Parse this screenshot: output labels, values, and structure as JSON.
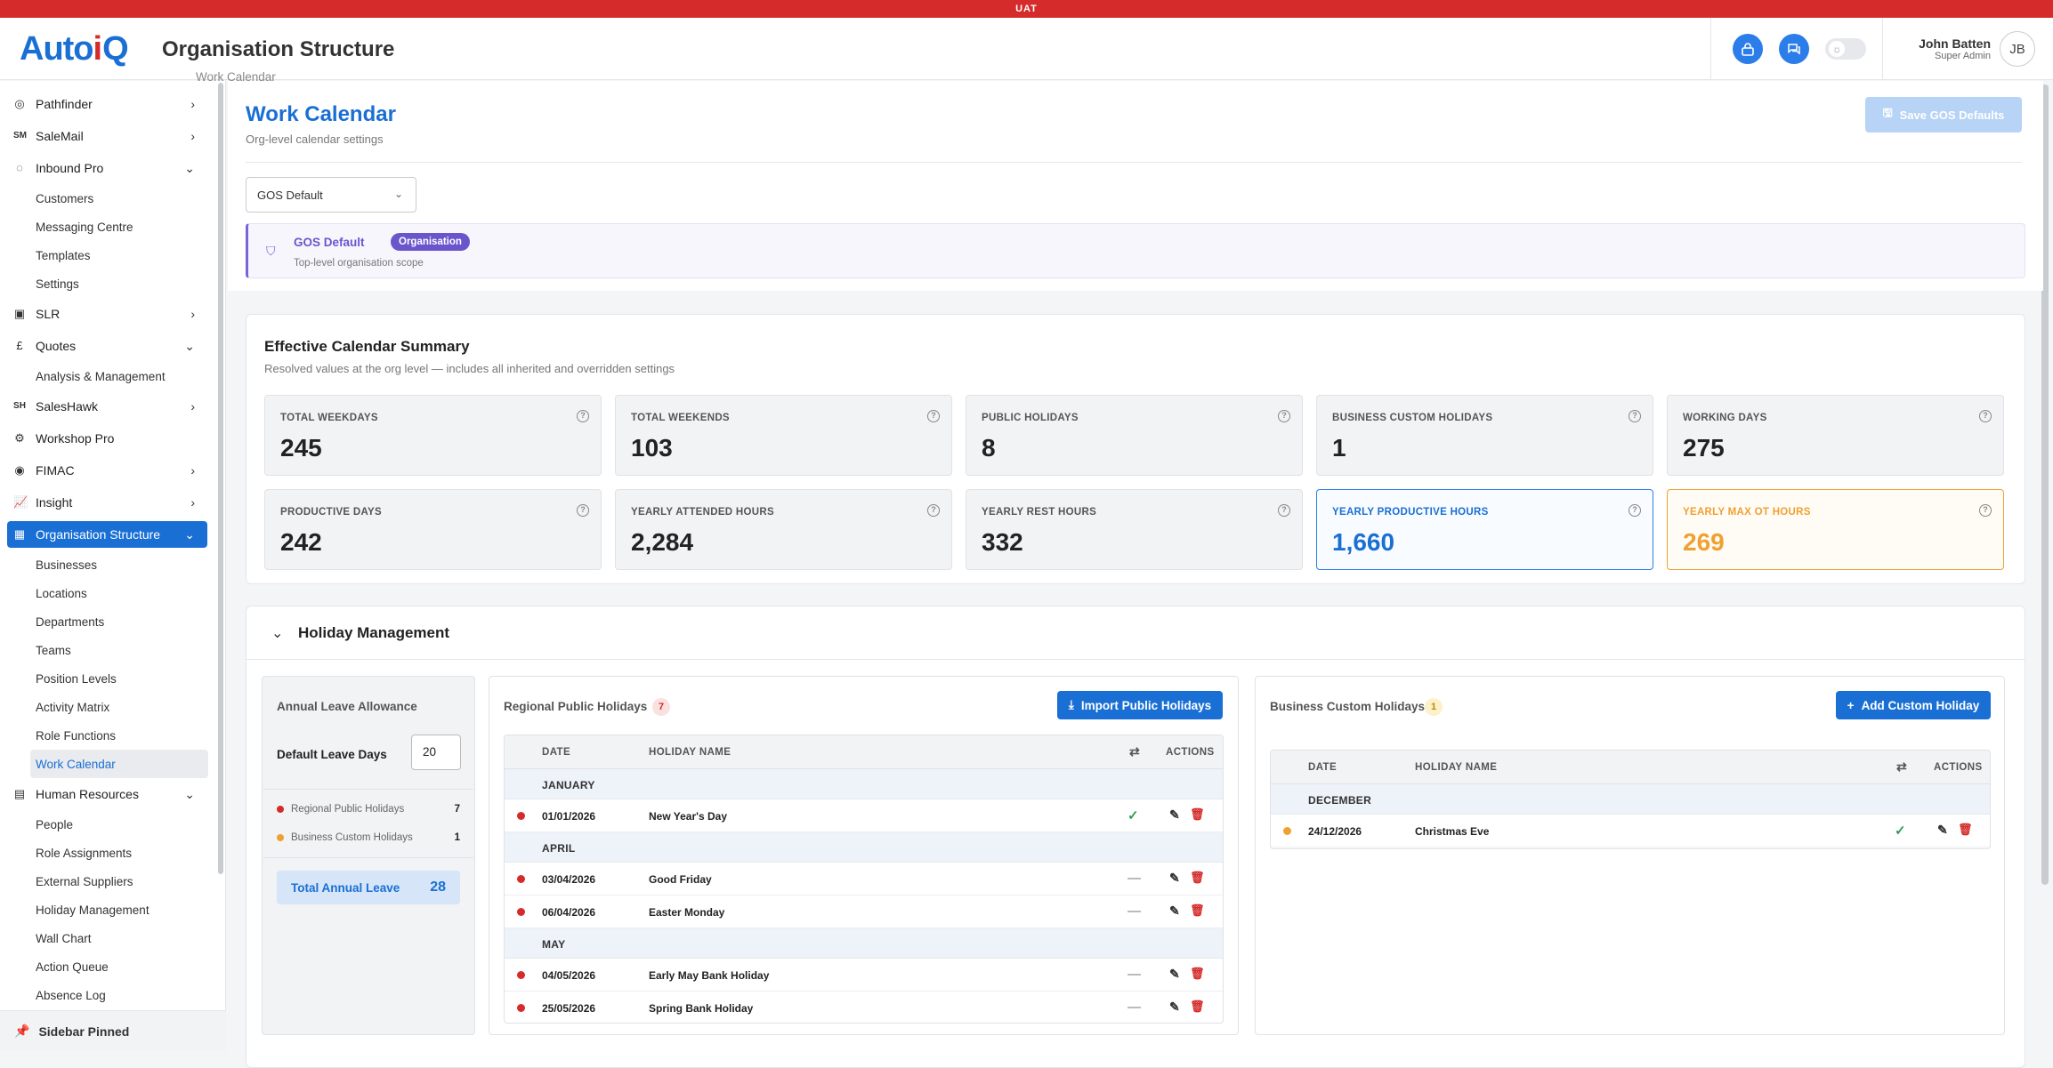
{
  "env_banner": "UAT",
  "app": {
    "logo_main": "Auto",
    "logo_accent": "i",
    "logo_tail": "Q"
  },
  "header": {
    "title": "Organisation Structure",
    "subtitle": "Work Calendar"
  },
  "user": {
    "name": "John Batten",
    "role": "Super Admin",
    "initials": "JB"
  },
  "sidebar": {
    "items": [
      {
        "label": "Pathfinder",
        "icon": "compass-icon"
      },
      {
        "label": "SaleMail",
        "icon": "salemail-icon"
      },
      {
        "label": "Inbound Pro",
        "icon": "inbound-icon"
      },
      {
        "label": "SLR",
        "icon": "slr-icon"
      },
      {
        "label": "Quotes",
        "icon": "quotes-icon"
      },
      {
        "label": "SalesHawk",
        "icon": "saleshawk-icon"
      },
      {
        "label": "Workshop Pro",
        "icon": "workshop-icon"
      },
      {
        "label": "FIMAC",
        "icon": "fimac-icon"
      },
      {
        "label": "Insight",
        "icon": "chart-icon"
      },
      {
        "label": "Organisation Structure",
        "icon": "building-icon"
      },
      {
        "label": "Human Resources",
        "icon": "hr-icon"
      }
    ],
    "inbound_sub": [
      "Customers",
      "Messaging Centre",
      "Templates",
      "Settings"
    ],
    "quotes_sub": [
      "Analysis & Management"
    ],
    "org_sub": [
      "Businesses",
      "Locations",
      "Departments",
      "Teams",
      "Position Levels",
      "Activity Matrix",
      "Role Functions",
      "Work Calendar"
    ],
    "hr_sub": [
      "People",
      "Role Assignments",
      "External Suppliers",
      "Holiday Management",
      "Wall Chart",
      "Action Queue",
      "Absence Log"
    ],
    "pinned": "Sidebar Pinned"
  },
  "page": {
    "title": "Work Calendar",
    "subtitle": "Org-level calendar settings",
    "save_button": "Save GOS Defaults",
    "scope_select": "GOS Default",
    "scope_title": "GOS Default",
    "scope_badge": "Organisation",
    "scope_desc": "Top-level organisation scope"
  },
  "summary": {
    "title": "Effective Calendar Summary",
    "subtitle": "Resolved values at the org level — includes all inherited and overridden settings",
    "cards": [
      {
        "label": "TOTAL WEEKDAYS",
        "value": "245"
      },
      {
        "label": "TOTAL WEEKENDS",
        "value": "103"
      },
      {
        "label": "PUBLIC HOLIDAYS",
        "value": "8"
      },
      {
        "label": "BUSINESS CUSTOM HOLIDAYS",
        "value": "1"
      },
      {
        "label": "WORKING DAYS",
        "value": "275"
      },
      {
        "label": "PRODUCTIVE DAYS",
        "value": "242"
      },
      {
        "label": "YEARLY ATTENDED HOURS",
        "value": "2,284"
      },
      {
        "label": "YEARLY REST HOURS",
        "value": "332"
      },
      {
        "label": "YEARLY PRODUCTIVE HOURS",
        "value": "1,660"
      },
      {
        "label": "YEARLY MAX OT HOURS",
        "value": "269"
      }
    ]
  },
  "holiday": {
    "title": "Holiday Management",
    "leave": {
      "title": "Annual Leave Allowance",
      "default_label": "Default Leave Days",
      "default_value": "20",
      "regional_label": "Regional Public Holidays",
      "regional_count": "7",
      "custom_label": "Business Custom Holidays",
      "custom_count": "1",
      "total_label": "Total Annual Leave",
      "total_value": "28"
    },
    "regional": {
      "title": "Regional Public Holidays",
      "count": "7",
      "button": "Import Public Holidays",
      "col_date": "DATE",
      "col_name": "HOLIDAY NAME",
      "col_actions": "ACTIONS",
      "months": [
        "JANUARY",
        "APRIL",
        "MAY"
      ],
      "rows": [
        {
          "date": "01/01/2026",
          "name": "New Year's Day",
          "status": "✓"
        },
        {
          "date": "03/04/2026",
          "name": "Good Friday",
          "status": "—"
        },
        {
          "date": "06/04/2026",
          "name": "Easter Monday",
          "status": "—"
        },
        {
          "date": "04/05/2026",
          "name": "Early May Bank Holiday",
          "status": "—"
        },
        {
          "date": "25/05/2026",
          "name": "Spring Bank Holiday",
          "status": "—"
        }
      ]
    },
    "custom": {
      "title": "Business Custom Holidays",
      "count": "1",
      "button": "Add Custom Holiday",
      "col_date": "DATE",
      "col_name": "HOLIDAY NAME",
      "col_actions": "ACTIONS",
      "months": [
        "DECEMBER"
      ],
      "rows": [
        {
          "date": "24/12/2026",
          "name": "Christmas Eve",
          "status": "✓"
        }
      ]
    }
  },
  "colors": {
    "accent": "#1a6fd4",
    "danger": "#d52b2b",
    "orange": "#f0a030",
    "purple": "#6a55cc",
    "success": "#2e9e4f"
  }
}
